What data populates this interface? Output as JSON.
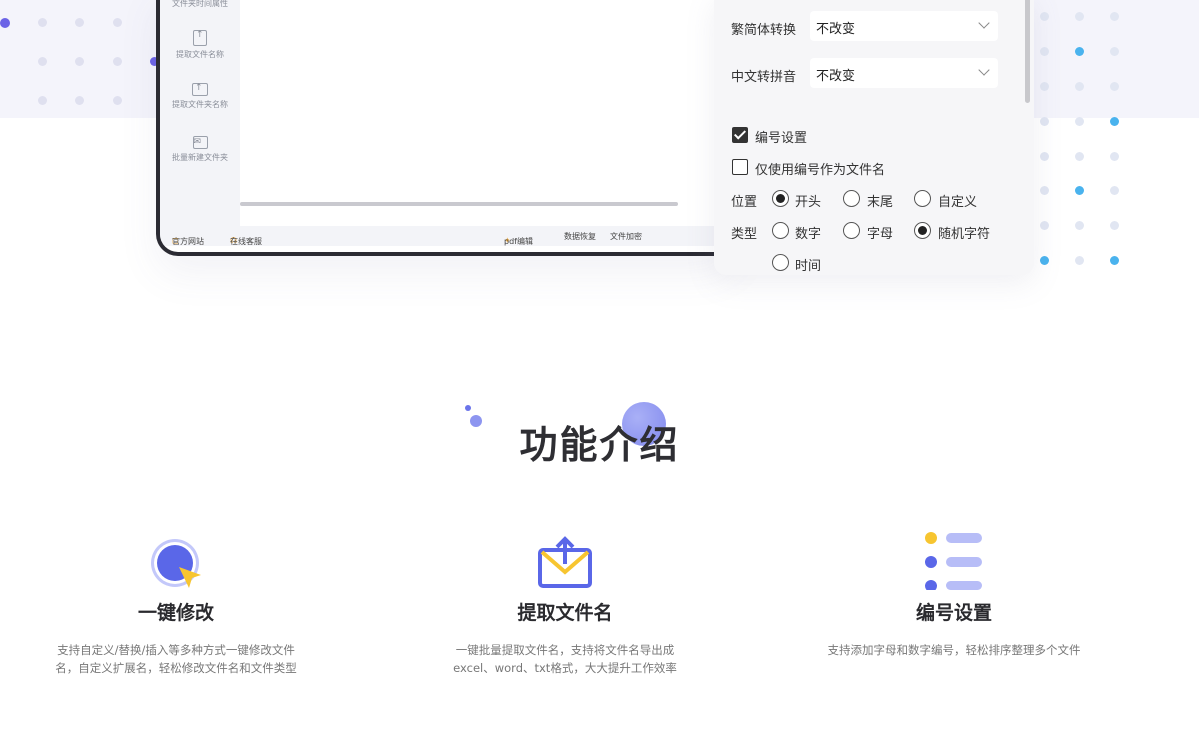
{
  "sidebar": {
    "items": [
      {
        "label": "文件夹时间属性"
      },
      {
        "label": "提取文件名称",
        "icon": "upload-file-icon"
      },
      {
        "label": "提取文件夹名称",
        "icon": "upload-folder-icon"
      },
      {
        "label": "批量新建文件夹",
        "icon": "mail-folder-icon"
      }
    ]
  },
  "footer": {
    "website": "官方网站",
    "support": "在线客服",
    "pdf": "pdf编辑",
    "recovery": "数据恢复",
    "encrypt": "文件加密"
  },
  "panel": {
    "convert_label": "繁简体转换",
    "convert_value": "不改变",
    "pinyin_label": "中文转拼音",
    "pinyin_value": "不改变",
    "numbering_label": "编号设置",
    "numbering_checked": true,
    "only_number_label": "仅使用编号作为文件名",
    "only_number_checked": false,
    "position_label": "位置",
    "position_options": [
      "开头",
      "末尾",
      "自定义"
    ],
    "position_selected": "开头",
    "type_label": "类型",
    "type_options": [
      "数字",
      "字母",
      "随机字符",
      "时间"
    ],
    "type_selected": "随机字符"
  },
  "section": {
    "title": "功能介绍"
  },
  "features": [
    {
      "title": "一键修改",
      "desc": "支持自定义/替换/插入等多种方式一键修改文件名，自定义扩展名，轻松修改文件名和文件类型",
      "icon": "cursor-click-icon"
    },
    {
      "title": "提取文件名",
      "desc": "一键批量提取文件名，支持将文件名导出成excel、word、txt格式，大大提升工作效率",
      "icon": "envelope-upload-icon"
    },
    {
      "title": "编号设置",
      "desc": "支持添加字母和数字编号，轻松排序整理多个文件",
      "icon": "numbered-list-icon"
    }
  ],
  "colors": {
    "accent": "#5a67e8",
    "accent_light": "#b7bdf7",
    "yellow": "#f7c530",
    "dot_blue": "#4ab3ee"
  }
}
